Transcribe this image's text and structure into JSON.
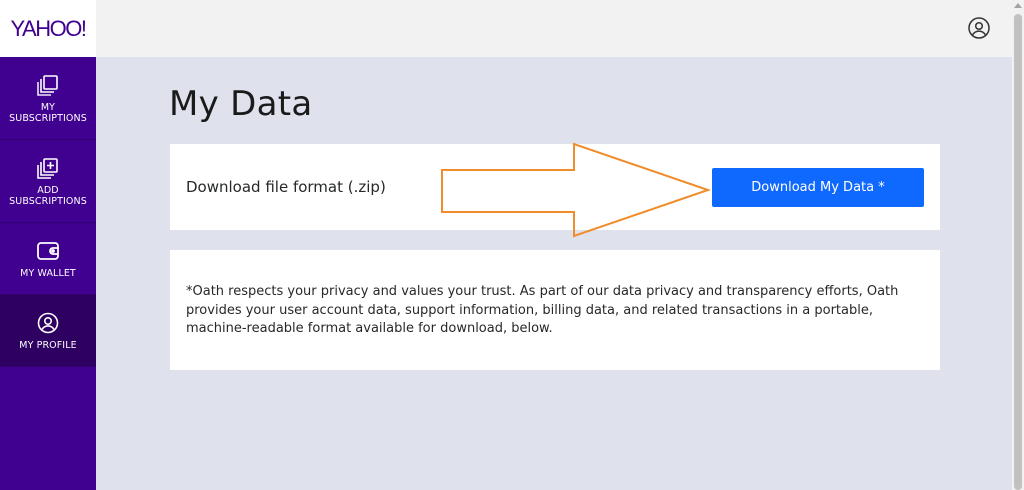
{
  "brand": {
    "logo_text": "YAHOO!",
    "color": "#400090"
  },
  "sidebar": {
    "items": [
      {
        "label": "MY\nSUBSCRIPTIONS",
        "icon": "subscriptions-icon",
        "active": false
      },
      {
        "label": "ADD\nSUBSCRIPTIONS",
        "icon": "add-subscriptions-icon",
        "active": false
      },
      {
        "label": "MY WALLET",
        "icon": "wallet-icon",
        "active": false
      },
      {
        "label": "MY PROFILE",
        "icon": "profile-icon",
        "active": true
      }
    ]
  },
  "header": {
    "account_icon": "account-circle-icon"
  },
  "main": {
    "title": "My Data",
    "download_card": {
      "format_label": "Download file format (.zip)",
      "button_label": "Download My Data *",
      "button_color": "#0f69ff"
    },
    "info_card": {
      "text": "*Oath respects your privacy and values your trust. As part of our data privacy and transparency efforts, Oath provides your user account data, support information, billing data, and related transactions in a portable, machine-readable format available for download, below."
    }
  },
  "annotation": {
    "arrow_color": "#f08c2a",
    "icon": "arrow-right-icon"
  }
}
